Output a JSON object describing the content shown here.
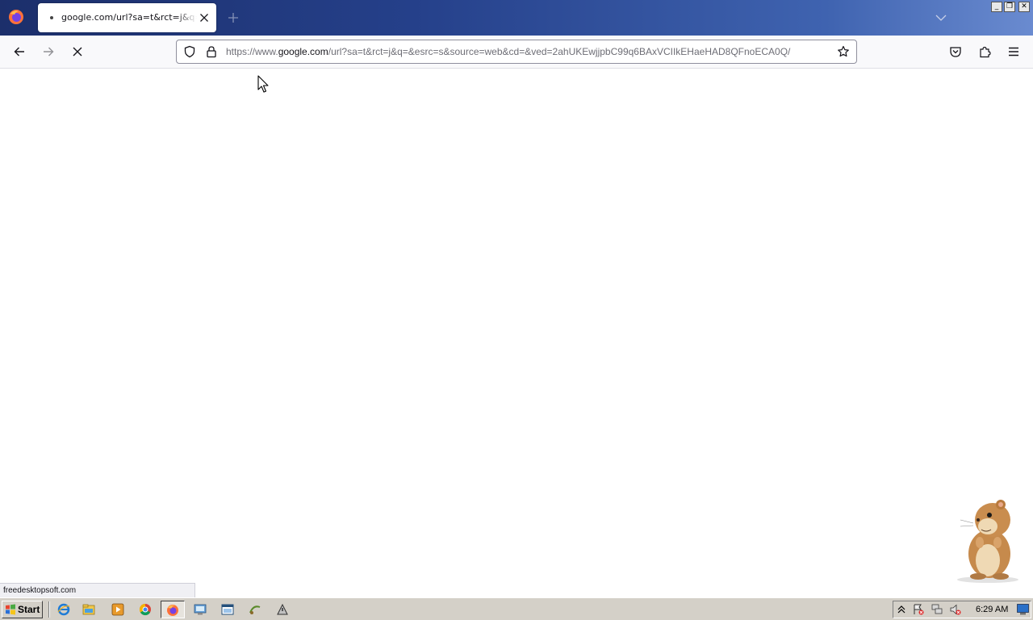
{
  "browser": {
    "tab": {
      "title": "google.com/url?sa=t&rct=j&q=&esrc=s&source=web&cd=&ved=2ahUKE"
    },
    "url": {
      "prefix": "https://www.",
      "host": "google.com",
      "path": "/url?sa=t&rct=j&q=&esrc=s&source=web&cd=&ved=2ahUKEwjjpbC99q6BAxVCIIkEHaeHAD8QFnoECA0Q/"
    },
    "status_text": "freedesktopsoft.com",
    "window_buttons": {
      "minimize": "_",
      "restore": "❐",
      "close": "✕"
    }
  },
  "icons": {
    "tab": [
      "firefox-icon",
      "close-icon",
      "plus-icon",
      "chevron-down-icon"
    ],
    "nav": [
      "back-arrow-icon",
      "forward-arrow-icon",
      "stop-icon",
      "shield-icon",
      "lock-icon",
      "star-icon",
      "pocket-icon",
      "extensions-icon",
      "hamburger-menu-icon"
    ],
    "taskbar": [
      "windows-flag-icon",
      "internet-explorer-icon",
      "file-explorer-icon",
      "media-player-icon",
      "chrome-icon",
      "firefox-icon",
      "network-icon",
      "window-icon",
      "app-icon",
      "tool-icon"
    ]
  },
  "taskbar": {
    "start_label": "Start",
    "clock": "6:29 AM"
  },
  "colors": {
    "tabstrip": "#25408a",
    "navbar": "#f9f9fb",
    "taskbar": "#d4d0c8"
  }
}
